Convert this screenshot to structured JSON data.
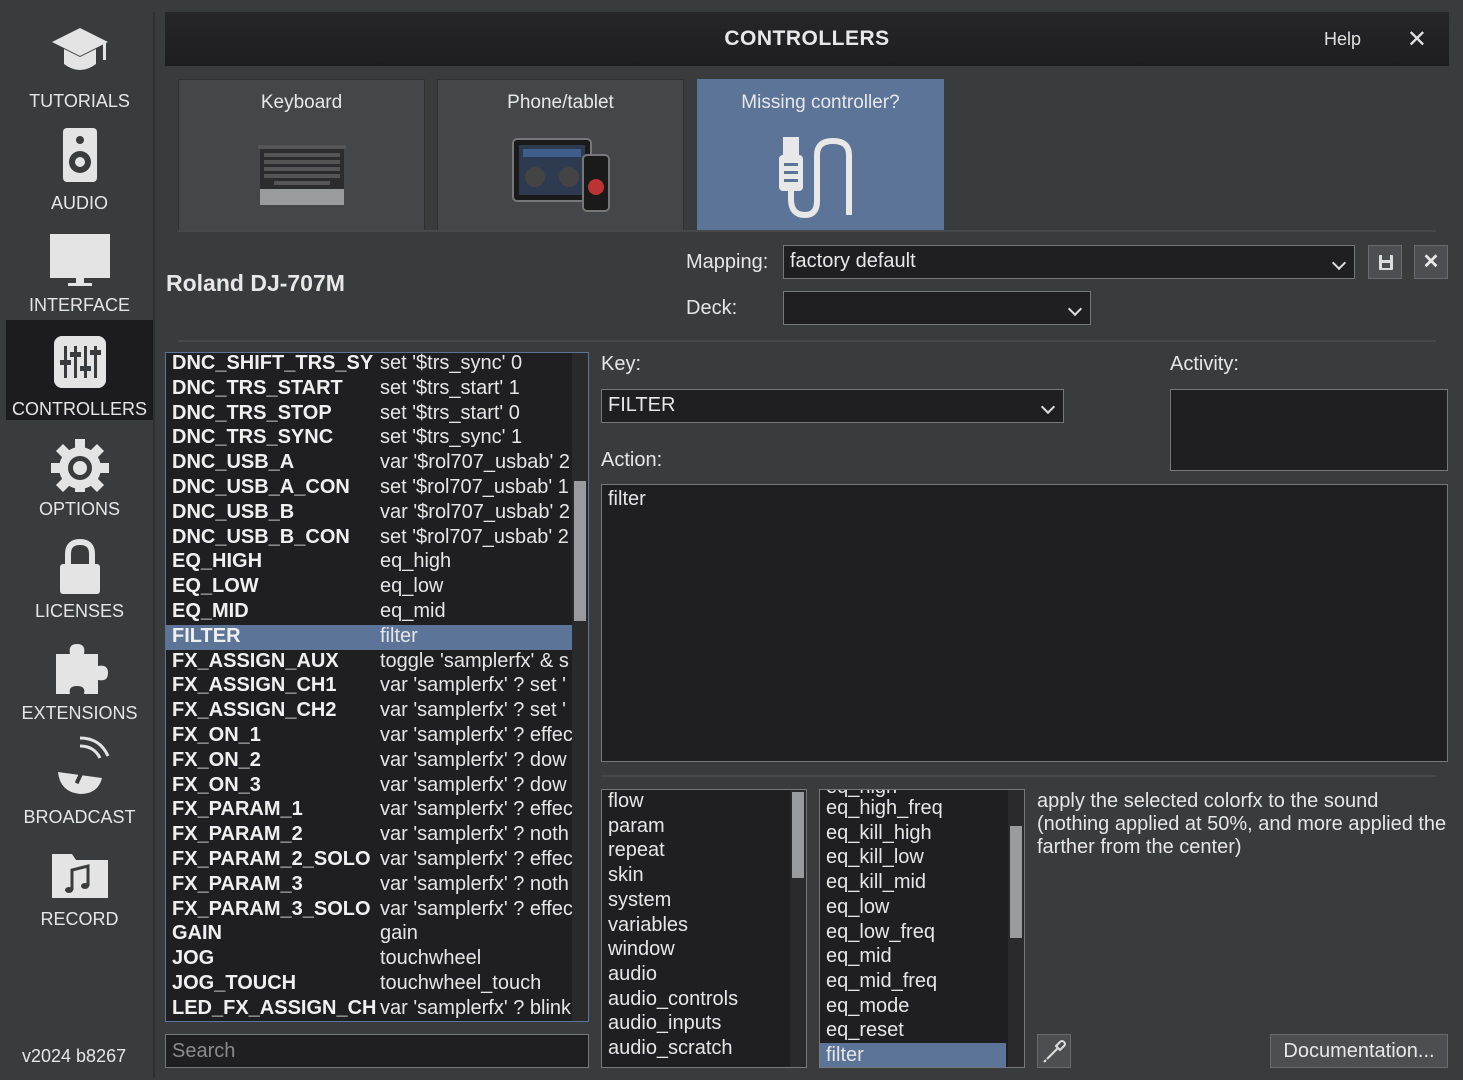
{
  "sidebar": {
    "items": [
      {
        "label": "TUTORIALS",
        "icon": "graduation-cap-icon"
      },
      {
        "label": "AUDIO",
        "icon": "speaker-icon"
      },
      {
        "label": "INTERFACE",
        "icon": "monitor-icon"
      },
      {
        "label": "CONTROLLERS",
        "icon": "sliders-icon",
        "active": true
      },
      {
        "label": "OPTIONS",
        "icon": "gear-icon"
      },
      {
        "label": "LICENSES",
        "icon": "lock-icon"
      },
      {
        "label": "EXTENSIONS",
        "icon": "puzzle-icon"
      },
      {
        "label": "BROADCAST",
        "icon": "satellite-dish-icon"
      },
      {
        "label": "RECORD",
        "icon": "music-folder-icon"
      }
    ],
    "version": "v2024 b8267"
  },
  "window": {
    "title": "CONTROLLERS",
    "help": "Help",
    "close": "✕"
  },
  "tiles": [
    {
      "label": "Keyboard",
      "icon": "laptop-keyboard-icon"
    },
    {
      "label": "Phone/tablet",
      "icon": "tablet-phone-icon"
    },
    {
      "label": "Missing controller?",
      "icon": "usb-cable-icon",
      "highlight": "#5b7497"
    }
  ],
  "device": {
    "name": "Roland DJ-707M"
  },
  "mapping": {
    "label": "Mapping:",
    "value": "factory default",
    "save_icon": "save-icon",
    "delete_icon": "✕",
    "deck_label": "Deck:",
    "deck_value": ""
  },
  "keys": {
    "selected_index": 11,
    "rows": [
      {
        "name": "DNC_SHIFT_TRS_SY",
        "action": "set '$trs_sync' 0"
      },
      {
        "name": "DNC_TRS_START",
        "action": "set '$trs_start' 1"
      },
      {
        "name": "DNC_TRS_STOP",
        "action": "set '$trs_start' 0"
      },
      {
        "name": "DNC_TRS_SYNC",
        "action": "set '$trs_sync' 1"
      },
      {
        "name": "DNC_USB_A",
        "action": "var '$rol707_usbab' 2"
      },
      {
        "name": "DNC_USB_A_CON",
        "action": "set '$rol707_usbab' 1"
      },
      {
        "name": "DNC_USB_B",
        "action": "var '$rol707_usbab' 2"
      },
      {
        "name": "DNC_USB_B_CON",
        "action": "set '$rol707_usbab' 2"
      },
      {
        "name": "EQ_HIGH",
        "action": "eq_high"
      },
      {
        "name": "EQ_LOW",
        "action": "eq_low"
      },
      {
        "name": "EQ_MID",
        "action": "eq_mid"
      },
      {
        "name": "FILTER",
        "action": "filter"
      },
      {
        "name": "FX_ASSIGN_AUX",
        "action": "toggle 'samplerfx' & s"
      },
      {
        "name": "FX_ASSIGN_CH1",
        "action": "var 'samplerfx' ? set '"
      },
      {
        "name": "FX_ASSIGN_CH2",
        "action": "var 'samplerfx' ? set '"
      },
      {
        "name": "FX_ON_1",
        "action": "var 'samplerfx' ? effec"
      },
      {
        "name": "FX_ON_2",
        "action": "var 'samplerfx' ? dow"
      },
      {
        "name": "FX_ON_3",
        "action": "var 'samplerfx' ? dow"
      },
      {
        "name": "FX_PARAM_1",
        "action": "var 'samplerfx' ? effec"
      },
      {
        "name": "FX_PARAM_2",
        "action": "var 'samplerfx' ? noth"
      },
      {
        "name": "FX_PARAM_2_SOLO",
        "action": "var 'samplerfx' ? effec"
      },
      {
        "name": "FX_PARAM_3",
        "action": "var 'samplerfx' ? noth"
      },
      {
        "name": "FX_PARAM_3_SOLO",
        "action": "var 'samplerfx' ? effec"
      },
      {
        "name": "GAIN",
        "action": "gain"
      },
      {
        "name": "JOG",
        "action": "touchwheel"
      },
      {
        "name": "JOG_TOUCH",
        "action": "touchwheel_touch"
      },
      {
        "name": "LED_FX_ASSIGN_CH",
        "action": "var 'samplerfx' ? blink"
      }
    ]
  },
  "search": {
    "placeholder": "Search"
  },
  "editor": {
    "key_label": "Key:",
    "key_value": "FILTER",
    "activity_label": "Activity:",
    "action_label": "Action:",
    "action_value": "filter"
  },
  "categories": {
    "items": [
      "flow",
      "param",
      "repeat",
      "skin",
      "system",
      "variables",
      "window",
      "audio",
      "audio_controls",
      "audio_inputs",
      "audio_scratch"
    ]
  },
  "verbs": {
    "partial_top": "eq_high",
    "items": [
      "eq_high_freq",
      "eq_kill_high",
      "eq_kill_low",
      "eq_kill_mid",
      "eq_low",
      "eq_low_freq",
      "eq_mid",
      "eq_mid_freq",
      "eq_mode",
      "eq_reset",
      "filter"
    ],
    "selected_index": 10
  },
  "description": {
    "text": "apply the selected colorfx to the sound (nothing applied at 50%, and more applied the farther from the center)"
  },
  "buttons": {
    "picker_icon": "eyedropper-icon",
    "documentation": "Documentation..."
  },
  "colors": {
    "accent": "#5b7497",
    "background": "#3a3b3d",
    "field": "#1f1f21"
  }
}
